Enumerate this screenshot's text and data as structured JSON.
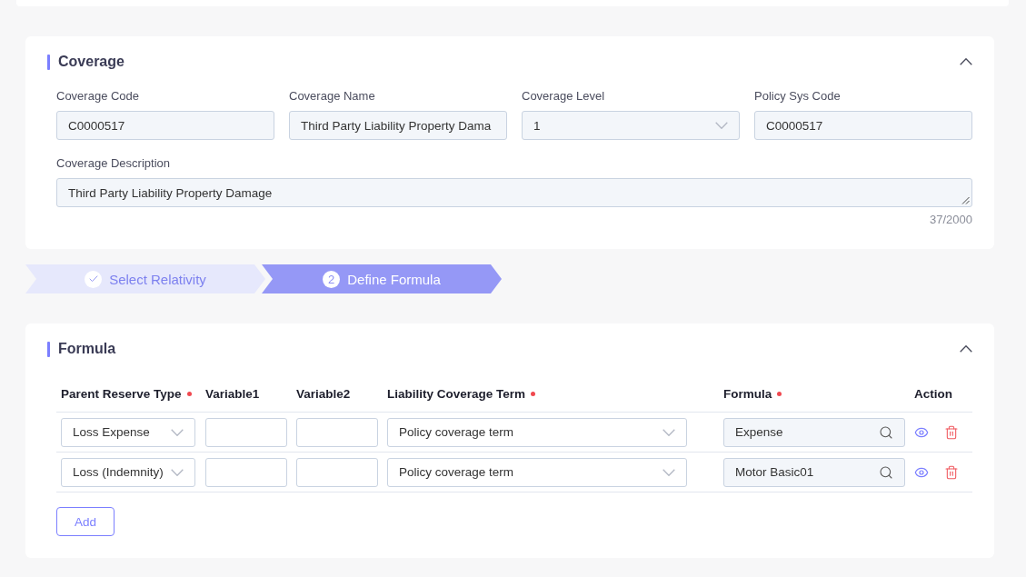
{
  "coverage": {
    "title": "Coverage",
    "expanded": true,
    "fields": [
      {
        "label": "Coverage Code",
        "value": "C0000517",
        "kind": "text",
        "disabled": true
      },
      {
        "label": "Coverage Name",
        "value": "Third Party Liability Property Dama",
        "kind": "text",
        "disabled": true
      },
      {
        "label": "Coverage Level",
        "value": "1",
        "kind": "select",
        "disabled": true
      },
      {
        "label": "Policy Sys Code",
        "value": "C0000517",
        "kind": "text",
        "disabled": true
      }
    ],
    "description": {
      "label": "Coverage Description",
      "value": "Third Party Liability Property Damage",
      "counter": "37/2000",
      "disabled": true
    }
  },
  "steps": [
    {
      "label": "Select Relativity",
      "completed": true,
      "selected": false
    },
    {
      "label": "Define Formula",
      "number": "2",
      "completed": false,
      "selected": true
    }
  ],
  "formula": {
    "title": "Formula",
    "expanded": true,
    "columns": [
      {
        "label": "Parent Reserve Type",
        "required": true
      },
      {
        "label": "Variable1",
        "required": false
      },
      {
        "label": "Variable2",
        "required": false
      },
      {
        "label": "Liability Coverage Term",
        "required": true
      },
      {
        "label": "Formula",
        "required": true
      },
      {
        "label": "Action",
        "required": false
      }
    ],
    "rows": [
      {
        "reserve_type": "Loss Expense",
        "coverage_term": "Policy coverage term",
        "formula": "Expense"
      },
      {
        "reserve_type": "Loss (Indemnity)",
        "coverage_term": "Policy coverage term",
        "formula": "Motor Basic01"
      }
    ],
    "add_button": "Add"
  }
}
